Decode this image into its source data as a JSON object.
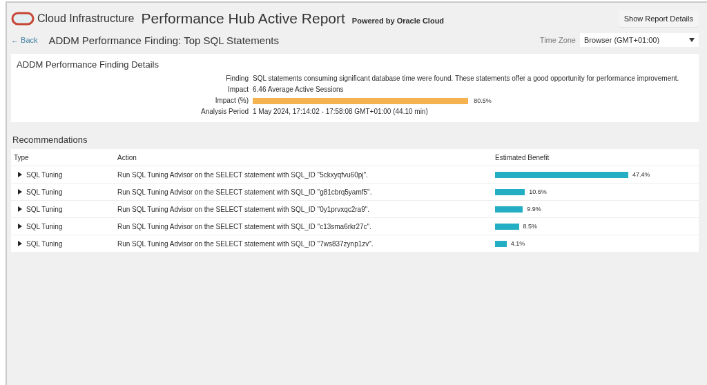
{
  "header": {
    "brand": "Cloud Infrastructure",
    "title": "Performance Hub Active Report",
    "subtitle": "Powered by Oracle Cloud",
    "button": "Show Report Details"
  },
  "nav": {
    "back": "← Back",
    "heading": "ADDM Performance Finding: Top SQL Statements",
    "time_zone_label": "Time Zone",
    "time_zone_value": "Browser (GMT+01:00)"
  },
  "details": {
    "title": "ADDM Performance Finding Details",
    "rows": [
      {
        "kind": "text",
        "label": "Finding",
        "value": "SQL statements consuming significant database time were found. These statements offer a good opportunity for performance improvement."
      },
      {
        "kind": "text",
        "label": "Impact",
        "value": "6.46 Average Active Sessions"
      },
      {
        "kind": "meter",
        "label": "Impact (%)",
        "value": "80.5%"
      },
      {
        "kind": "text",
        "label": "Analysis Period",
        "value": "1 May 2024, 17:14:02 - 17:58:08 GMT+01:00 (44.10 min)"
      }
    ]
  },
  "recommendations": {
    "title": "Recommendations",
    "columns": [
      "Type",
      "Action",
      "Estimated Benefit"
    ],
    "rows": [
      {
        "type": "SQL Tuning",
        "expanded": false,
        "action": "Run SQL Tuning Advisor on the SELECT statement with SQL_ID \"5ckxyqfvu60pj\".",
        "benefit": "47.4%"
      },
      {
        "type": "SQL Tuning",
        "expanded": false,
        "action": "Run SQL Tuning Advisor on the SELECT statement with SQL_ID \"g81cbrq5yamf5\".",
        "benefit": "10.6%"
      },
      {
        "type": "SQL Tuning",
        "expanded": false,
        "action": "Run SQL Tuning Advisor on the SELECT statement with SQL_ID \"0y1prvxqc2ra9\".",
        "benefit": "9.9%"
      },
      {
        "type": "SQL Tuning",
        "expanded": false,
        "action": "Run SQL Tuning Advisor on the SELECT statement with SQL_ID \"c13sma6rkr27c\".",
        "benefit": "8.5%"
      },
      {
        "type": "SQL Tuning",
        "expanded": false,
        "action": "Run SQL Tuning Advisor on the SELECT statement with SQL_ID \"7ws837zynp1zv\".",
        "benefit": "4.1%"
      }
    ]
  }
}
